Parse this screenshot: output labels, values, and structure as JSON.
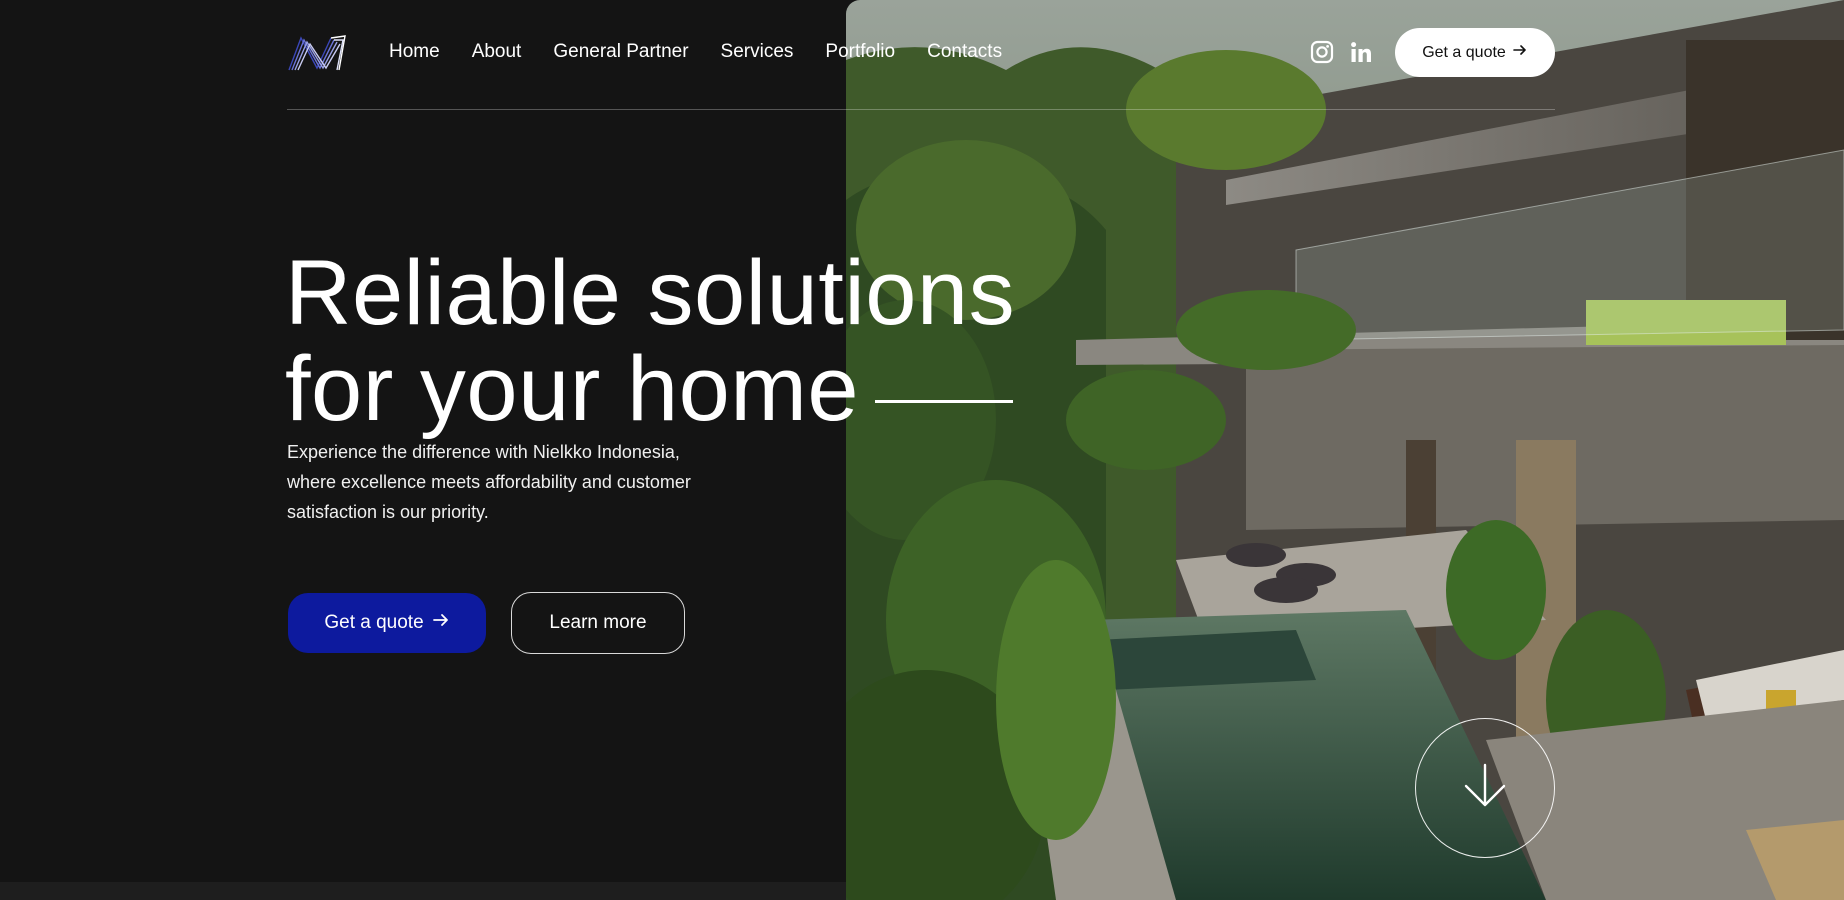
{
  "nav": {
    "links": [
      "Home",
      "About",
      "General Partner",
      "Services",
      "Portfolio",
      "Contacts"
    ],
    "cta_label": "Get a quote"
  },
  "social": [
    "instagram-icon",
    "linkedin-icon"
  ],
  "hero": {
    "headline_line1": "Reliable solutions",
    "headline_line2": "for your home",
    "subtext": "Experience the difference with Nielkko Indonesia, where excellence meets affordability and customer satisfaction is our priority.",
    "primary_cta": "Get a quote",
    "secondary_cta": "Learn more"
  },
  "colors": {
    "background": "#141414",
    "accent": "#0d1a9e",
    "text": "#ffffff"
  }
}
